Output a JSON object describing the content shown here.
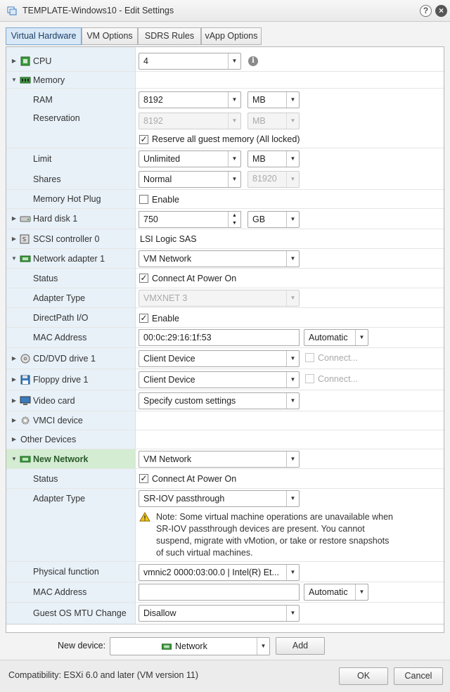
{
  "window": {
    "title": "TEMPLATE-Windows10 - Edit Settings",
    "help_glyph": "?",
    "close_glyph": "×"
  },
  "tabs": [
    {
      "label": "Virtual Hardware",
      "active": true
    },
    {
      "label": "VM Options",
      "active": false
    },
    {
      "label": "SDRS Rules",
      "active": false
    },
    {
      "label": "vApp Options",
      "active": false
    }
  ],
  "hardware": {
    "cpu": {
      "label": "CPU",
      "value": "4"
    },
    "memory": {
      "label": "Memory",
      "ram": {
        "label": "RAM",
        "value": "8192",
        "unit": "MB"
      },
      "reservation": {
        "label": "Reservation",
        "value": "8192",
        "unit": "MB"
      },
      "reserve_all": {
        "label": "Reserve all guest memory (All locked)",
        "checked": true
      },
      "limit": {
        "label": "Limit",
        "value": "Unlimited",
        "unit": "MB"
      },
      "shares": {
        "label": "Shares",
        "value": "Normal",
        "amount": "81920"
      },
      "hot_plug": {
        "label": "Memory Hot Plug",
        "option": "Enable",
        "checked": false
      }
    },
    "hard_disk": {
      "label": "Hard disk 1",
      "value": "750",
      "unit": "GB"
    },
    "scsi": {
      "label": "SCSI controller 0",
      "value": "LSI Logic SAS"
    },
    "network_adapter": {
      "label": "Network adapter 1",
      "network": "VM Network",
      "status": {
        "label": "Status",
        "option": "Connect At Power On",
        "checked": true
      },
      "adapter_type": {
        "label": "Adapter Type",
        "value": "VMXNET 3"
      },
      "directpath": {
        "label": "DirectPath I/O",
        "option": "Enable",
        "checked": true
      },
      "mac": {
        "label": "MAC Address",
        "value": "00:0c:29:16:1f:53",
        "mode": "Automatic"
      }
    },
    "cd_dvd": {
      "label": "CD/DVD drive 1",
      "value": "Client Device",
      "connect": "Connect..."
    },
    "floppy": {
      "label": "Floppy drive 1",
      "value": "Client Device",
      "connect": "Connect..."
    },
    "video": {
      "label": "Video card",
      "value": "Specify custom settings"
    },
    "vmci": {
      "label": "VMCI device"
    },
    "other": {
      "label": "Other Devices"
    },
    "new_network": {
      "label": "New Network",
      "network": "VM Network",
      "status": {
        "label": "Status",
        "option": "Connect At Power On",
        "checked": true
      },
      "adapter_type": {
        "label": "Adapter Type",
        "value": "SR-IOV passthrough"
      },
      "note_lines": [
        "Note: Some virtual machine operations are unavailable when",
        "SR-IOV passthrough devices are present. You cannot",
        "suspend, migrate with vMotion, or take or restore snapshots",
        "of such virtual machines."
      ],
      "physical_function": {
        "label": "Physical function",
        "value": "vmnic2 0000:03:00.0 | Intel(R) Et..."
      },
      "mac": {
        "label": "MAC Address",
        "value": "",
        "mode": "Automatic"
      },
      "mtu": {
        "label": "Guest OS MTU Change",
        "value": "Disallow"
      }
    }
  },
  "new_device": {
    "label": "New device:",
    "selected": "Network",
    "add_label": "Add"
  },
  "footer": {
    "compatibility": "Compatibility: ESXi 6.0 and later (VM version 11)",
    "ok_label": "OK",
    "cancel_label": "Cancel"
  },
  "colors": {
    "tab_active_bg": "#d9e8f6",
    "label_column_bg": "#e8f1f8",
    "highlight_row_bg": "#d3ecd2",
    "network_icon_green": "#3d9b3d"
  },
  "icons": [
    "vm-settings-icon",
    "help-icon",
    "close-icon",
    "cpu-icon",
    "memory-icon",
    "hard-disk-icon",
    "scsi-icon",
    "network-adapter-icon",
    "cd-dvd-icon",
    "floppy-icon",
    "video-card-icon",
    "vmci-gear-icon",
    "info-icon",
    "warning-icon"
  ]
}
